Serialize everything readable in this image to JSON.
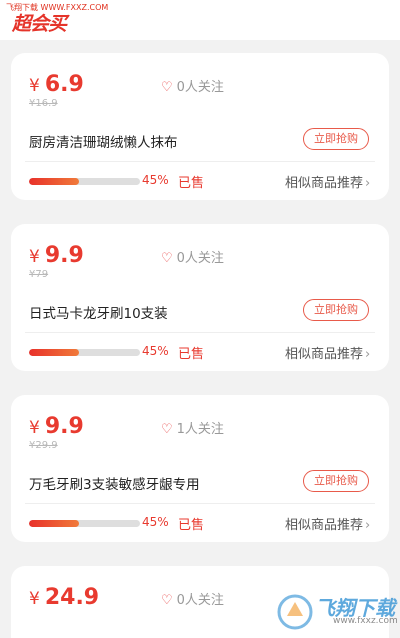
{
  "header": {
    "source_label": "飞翔下载 WWW.FXXZ.COM",
    "brand": "超会买"
  },
  "colors": {
    "accent": "#e83a2f",
    "background": "#f2f2f2"
  },
  "cards": [
    {
      "currency": "¥",
      "price": "6.9",
      "original_price": "¥16.9",
      "follow_count": "0人关注",
      "title": "厨房清洁珊瑚绒懒人抹布",
      "buy_label": "立即抢购",
      "sold_percent_label": "45%",
      "sold_fraction": 0.45,
      "sold_label": "已售",
      "similar_label": "相似商品推荐"
    },
    {
      "currency": "¥",
      "price": "9.9",
      "original_price": "¥79",
      "follow_count": "0人关注",
      "title": "日式马卡龙牙刷10支装",
      "buy_label": "立即抢购",
      "sold_percent_label": "45%",
      "sold_fraction": 0.45,
      "sold_label": "已售",
      "similar_label": "相似商品推荐"
    },
    {
      "currency": "¥",
      "price": "9.9",
      "original_price": "¥29.9",
      "follow_count": "1人关注",
      "title": "万毛牙刷3支装敏感牙龈专用",
      "buy_label": "立即抢购",
      "sold_percent_label": "45%",
      "sold_fraction": 0.45,
      "sold_label": "已售",
      "similar_label": "相似商品推荐"
    },
    {
      "currency": "¥",
      "price": "24.9",
      "follow_count": "0人关注"
    }
  ],
  "watermark": {
    "text": "飞翔下载",
    "url": "www.fxxz.com"
  }
}
